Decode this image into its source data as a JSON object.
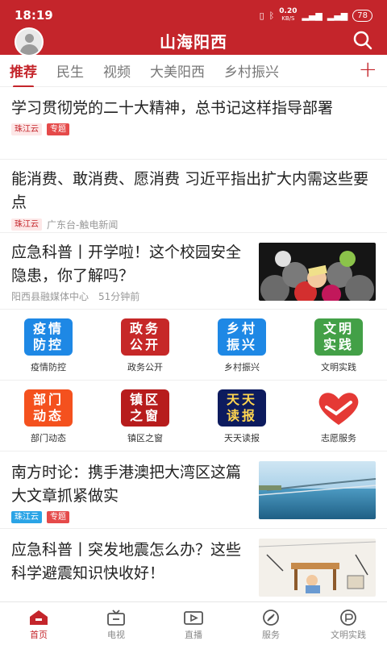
{
  "status_bar": {
    "time": "18:19",
    "net_speed": "0.20",
    "net_unit": "KB/S",
    "battery": "78"
  },
  "header": {
    "title": "山海阳西"
  },
  "tabs": [
    {
      "label": "推荐",
      "active": true
    },
    {
      "label": "民生"
    },
    {
      "label": "视频"
    },
    {
      "label": "大美阳西"
    },
    {
      "label": "乡村振兴"
    }
  ],
  "articles": [
    {
      "title": "学习贯彻党的二十大精神，总书记这样指导部署",
      "tags": [
        "珠江云",
        "专题"
      ]
    },
    {
      "title": "能消费、敢消费、愿消费 习近平指出扩大内需这些要点",
      "tags": [
        "珠江云"
      ],
      "source": "广东台-触电新闻"
    },
    {
      "title": "应急科普丨开学啦！这个校园安全隐患，你了解吗？",
      "source": "阳西县融媒体中心",
      "time": "51分钟前"
    },
    {
      "title": "南方时论：携手港澳把大湾区这篇大文章抓紧做实",
      "tags": [
        "珠江云",
        "专题"
      ]
    },
    {
      "title": "应急科普丨突发地震怎么办？这些科学避震知识快收好！"
    }
  ],
  "grid": [
    {
      "icon": [
        "疫情",
        "防控"
      ],
      "label": "疫情防控",
      "color": "#1e88e5"
    },
    {
      "icon": [
        "政务",
        "公开"
      ],
      "label": "政务公开",
      "color": "#c62828"
    },
    {
      "icon": [
        "乡村",
        "振兴"
      ],
      "label": "乡村振兴",
      "color": "#1e88e5"
    },
    {
      "icon": [
        "文明",
        "实践"
      ],
      "label": "文明实践",
      "color": "#43a047"
    },
    {
      "icon": [
        "部门",
        "动态"
      ],
      "label": "部门动态",
      "color": "#f4511e"
    },
    {
      "icon": [
        "镇区",
        "之窗"
      ],
      "label": "镇区之窗",
      "color": "#b71c1c"
    },
    {
      "icon": [
        "天天",
        "读报"
      ],
      "label": "天天读报",
      "color": "#0d1b5e"
    },
    {
      "icon": "heart-hand-icon",
      "label": "志愿服务",
      "color": "#e53935"
    }
  ],
  "bottom_nav": [
    {
      "label": "首页",
      "icon": "home-icon",
      "active": true
    },
    {
      "label": "电视",
      "icon": "tv-icon"
    },
    {
      "label": "直播",
      "icon": "live-icon"
    },
    {
      "label": "服务",
      "icon": "compass-icon"
    },
    {
      "label": "文明实践",
      "icon": "civilization-icon"
    }
  ],
  "colors": {
    "brand": "#c4252b"
  }
}
